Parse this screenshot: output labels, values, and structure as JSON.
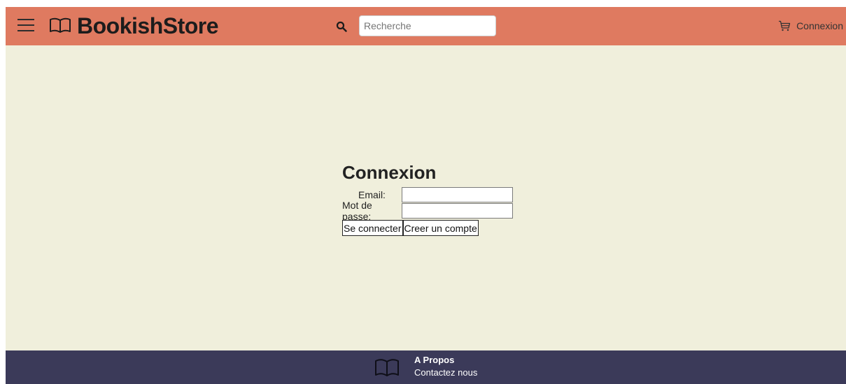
{
  "header": {
    "brand": "BookishStore",
    "search_placeholder": "Recherche",
    "login_label": "Connexion"
  },
  "login_form": {
    "title": "Connexion",
    "email_label": "Email:",
    "password_label": "Mot de passe:",
    "submit_label": "Se connecter",
    "create_account_label": "Creer un compte"
  },
  "footer": {
    "about": "A Propos",
    "contact": "Contactez nous"
  },
  "colors": {
    "header_bg": "#df7a60",
    "page_bg": "#f0efdc",
    "footer_bg": "#3b3a59"
  },
  "icons": {
    "menu": "hamburger-menu-icon",
    "logo": "open-book-icon",
    "search": "magnifier-icon",
    "cart": "shopping-cart-icon",
    "footer": "open-book-icon"
  }
}
